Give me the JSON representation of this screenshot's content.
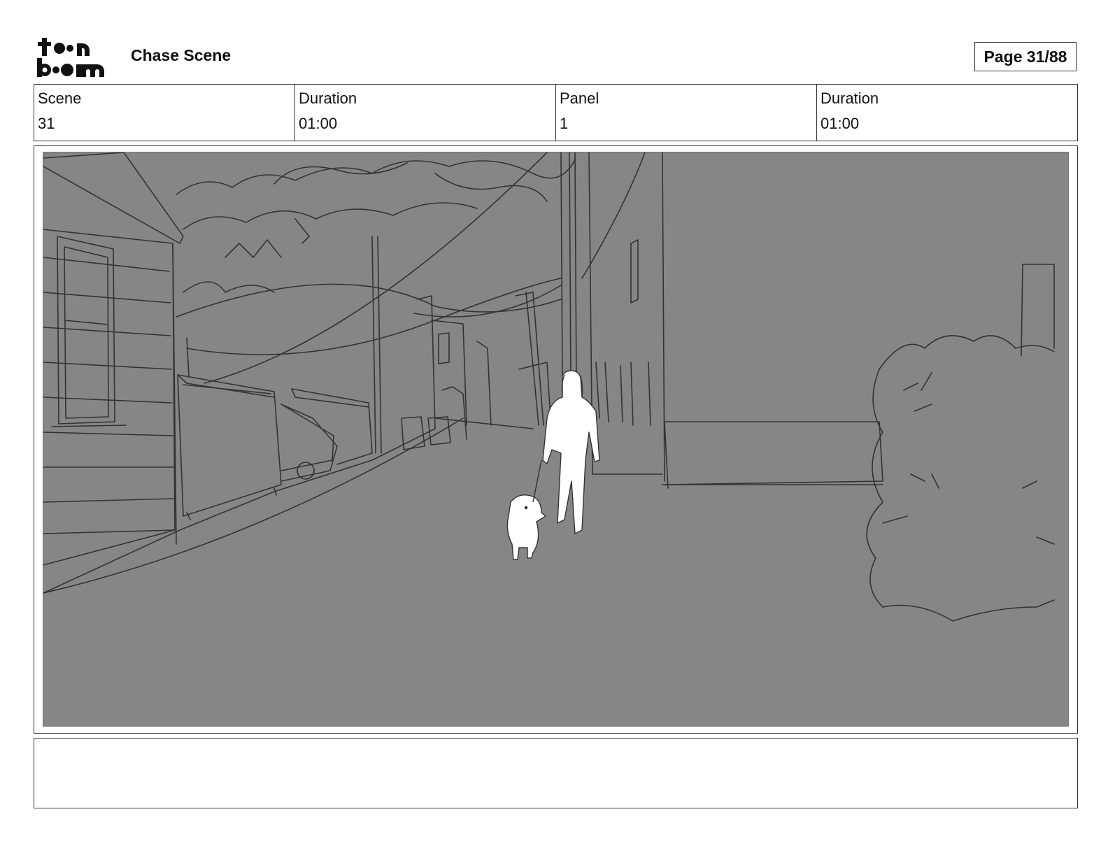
{
  "header": {
    "logo_text": "toon boom",
    "title": "Chase Scene",
    "page": "Page 31/88"
  },
  "info": {
    "scene_label": "Scene",
    "scene_value": "31",
    "scene_duration_label": "Duration",
    "scene_duration_value": "01:00",
    "panel_label": "Panel",
    "panel_value": "1",
    "panel_duration_label": "Duration",
    "panel_duration_value": "01:00"
  },
  "notes": {
    "text": ""
  },
  "colors": {
    "panel_background": "#868686",
    "sketch_line": "#333333",
    "figure_fill": "#ffffff"
  }
}
